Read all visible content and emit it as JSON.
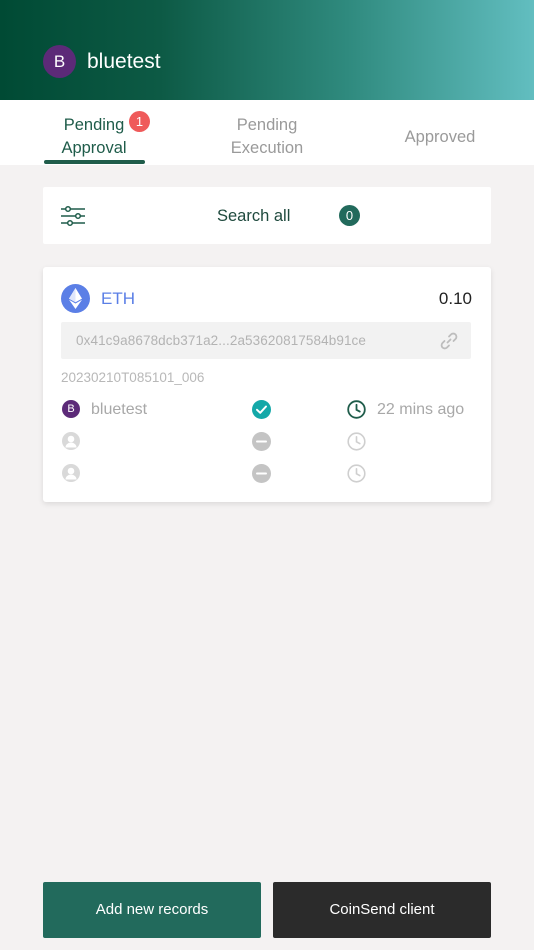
{
  "header": {
    "avatar_initial": "B",
    "username": "bluetest",
    "colors": {
      "start": "#004a34",
      "end": "#62bec0"
    }
  },
  "tabs": [
    {
      "line1": "Pending",
      "line2": "Approval",
      "badge": "1",
      "active": true
    },
    {
      "line1": "Pending",
      "line2": "Execution",
      "active": false
    },
    {
      "line1": "Approved",
      "active": false
    }
  ],
  "search": {
    "icon": "filter-sliders-icon",
    "label": "Search all",
    "count": "0"
  },
  "record": {
    "coin_icon": "ethereum-icon",
    "coin": "ETH",
    "amount": "0.10",
    "address": "0x41c9a8678dcb371a2...2a53620817584b91ce",
    "address_icon": "link-icon",
    "id": "20230210T085101_006",
    "approvers": [
      {
        "initial": "B",
        "name": "bluetest",
        "status": "approved",
        "time": "22 mins ago"
      },
      {
        "initial": "",
        "name": "",
        "status": "pending",
        "time": ""
      },
      {
        "initial": "",
        "name": "",
        "status": "pending",
        "time": ""
      }
    ]
  },
  "actions": {
    "add_label": "Add new records",
    "client_label": "CoinSend client"
  },
  "colors": {
    "primary": "#226a5c",
    "badge_red": "#ef5a5a",
    "eth_blue": "#5b7fe6",
    "avatar_purple": "#5c2a78",
    "check_teal": "#14a8a8"
  }
}
